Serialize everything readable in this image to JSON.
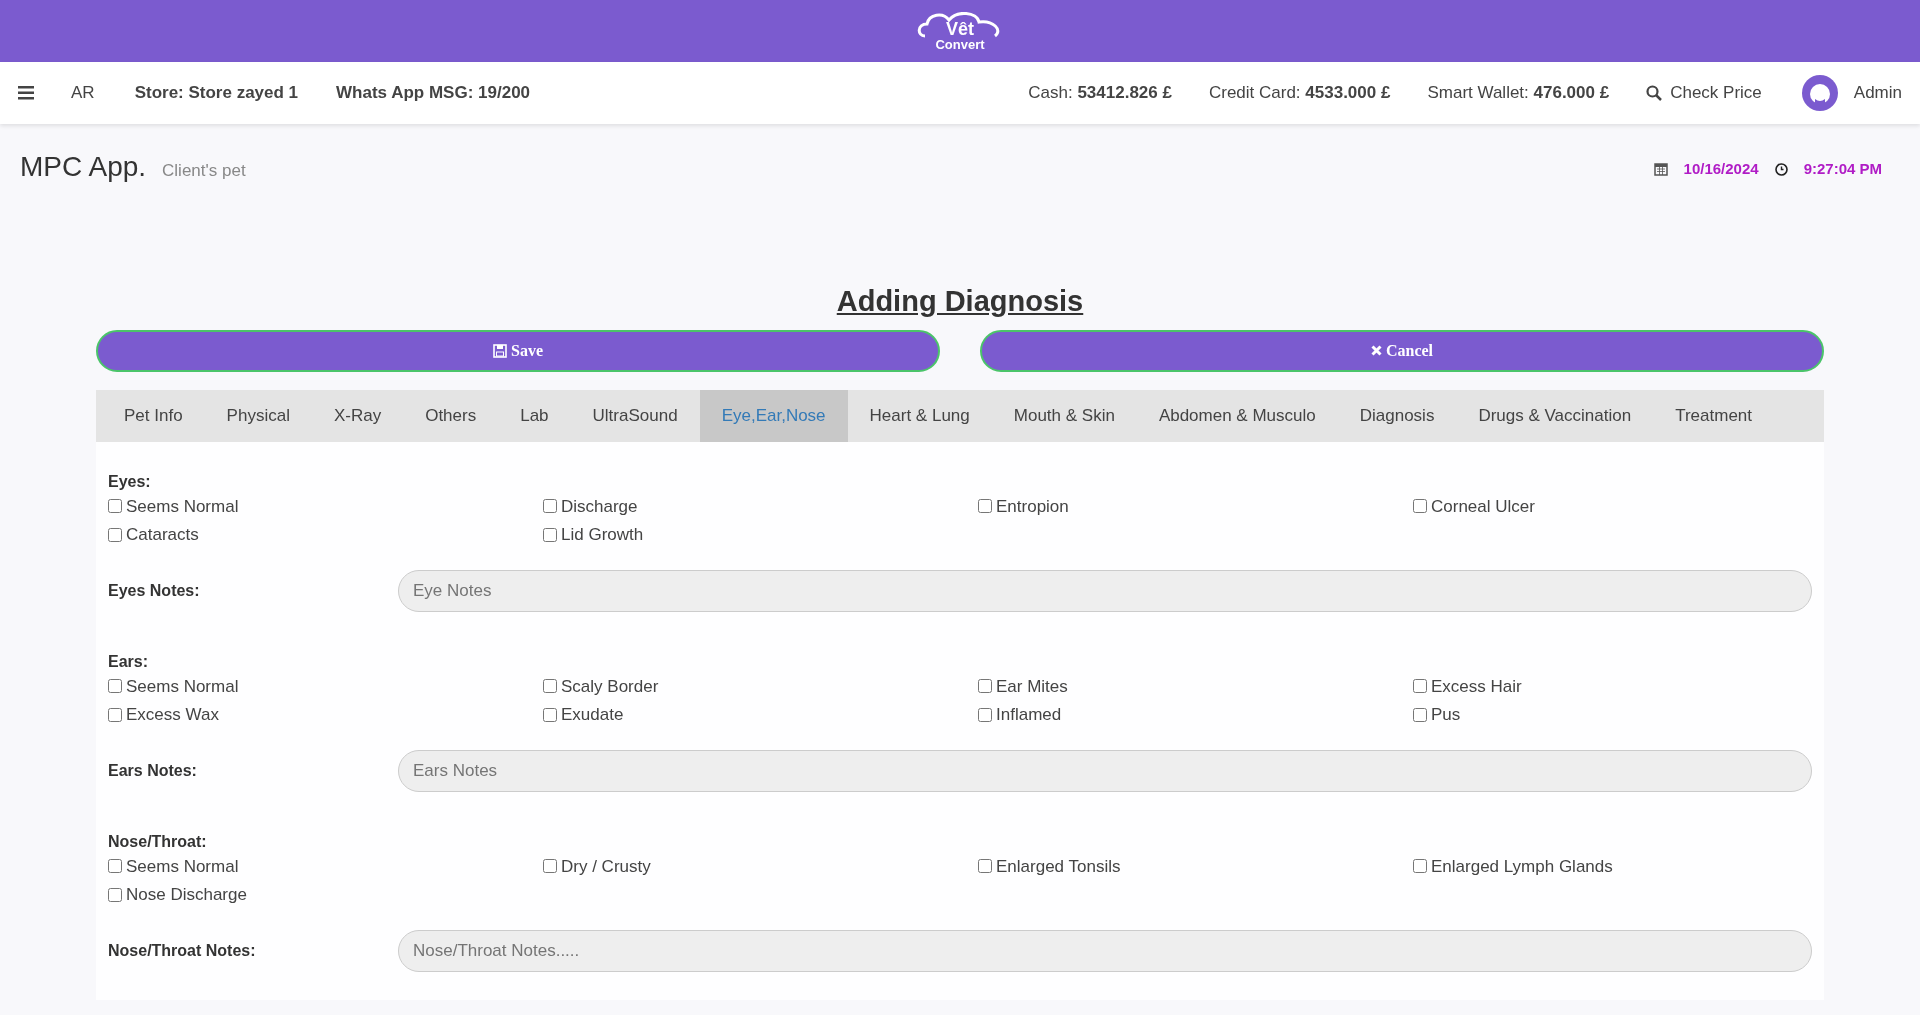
{
  "header": {
    "logo_top": "Vêt",
    "logo_bottom": "Convert"
  },
  "navbar": {
    "language": "AR",
    "store": "Store: Store zayed 1",
    "whatsapp": "Whats App MSG: 19/200",
    "balances": [
      {
        "label": "Cash:",
        "value": "53412.826 £"
      },
      {
        "label": "Credit Card:",
        "value": "4533.000 £"
      },
      {
        "label": "Smart Wallet:",
        "value": "476.000 £"
      }
    ],
    "check_price": "Check Price",
    "user": "Admin"
  },
  "page": {
    "title": "MPC App.",
    "subtitle": "Client's pet",
    "date": "10/16/2024",
    "time": "9:27:04 PM"
  },
  "form": {
    "heading": "Adding Diagnosis",
    "save": "Save",
    "cancel": "Cancel",
    "tabs": [
      {
        "label": "Pet Info",
        "selected": false
      },
      {
        "label": "Physical",
        "selected": false
      },
      {
        "label": "X-Ray",
        "selected": false
      },
      {
        "label": "Others",
        "selected": false
      },
      {
        "label": "Lab",
        "selected": false
      },
      {
        "label": "UltraSound",
        "selected": false
      },
      {
        "label": "Eye,Ear,Nose",
        "selected": true
      },
      {
        "label": "Heart & Lung",
        "selected": false
      },
      {
        "label": "Mouth & Skin",
        "selected": false
      },
      {
        "label": "Abdomen & Musculo",
        "selected": false
      },
      {
        "label": "Diagnosis",
        "selected": false
      },
      {
        "label": "Drugs & Vaccination",
        "selected": false
      },
      {
        "label": "Treatment",
        "selected": false
      }
    ],
    "sections": [
      {
        "title": "Eyes:",
        "options": [
          {
            "label": "Seems Normal",
            "checked": false
          },
          {
            "label": "Discharge",
            "checked": false
          },
          {
            "label": "Entropion",
            "checked": false
          },
          {
            "label": "Corneal Ulcer",
            "checked": false
          },
          {
            "label": "Cataracts",
            "checked": false
          },
          {
            "label": "Lid Growth",
            "checked": false
          }
        ],
        "notes_label": "Eyes Notes:",
        "notes_placeholder": "Eye Notes"
      },
      {
        "title": "Ears:",
        "options": [
          {
            "label": "Seems Normal",
            "checked": false
          },
          {
            "label": "Scaly Border",
            "checked": false
          },
          {
            "label": "Ear Mites",
            "checked": false
          },
          {
            "label": "Excess Hair",
            "checked": false
          },
          {
            "label": "Excess Wax",
            "checked": false
          },
          {
            "label": "Exudate",
            "checked": false
          },
          {
            "label": "Inflamed",
            "checked": false
          },
          {
            "label": "Pus",
            "checked": false
          }
        ],
        "notes_label": "Ears Notes:",
        "notes_placeholder": "Ears Notes"
      },
      {
        "title": "Nose/Throat:",
        "options": [
          {
            "label": "Seems Normal",
            "checked": false
          },
          {
            "label": "Dry / Crusty",
            "checked": false
          },
          {
            "label": "Enlarged Tonsils",
            "checked": false
          },
          {
            "label": "Enlarged Lymph Glands",
            "checked": false
          },
          {
            "label": "Nose Discharge",
            "checked": false
          }
        ],
        "notes_label": "Nose/Throat Notes:",
        "notes_placeholder": "Nose/Throat Notes....."
      }
    ]
  }
}
